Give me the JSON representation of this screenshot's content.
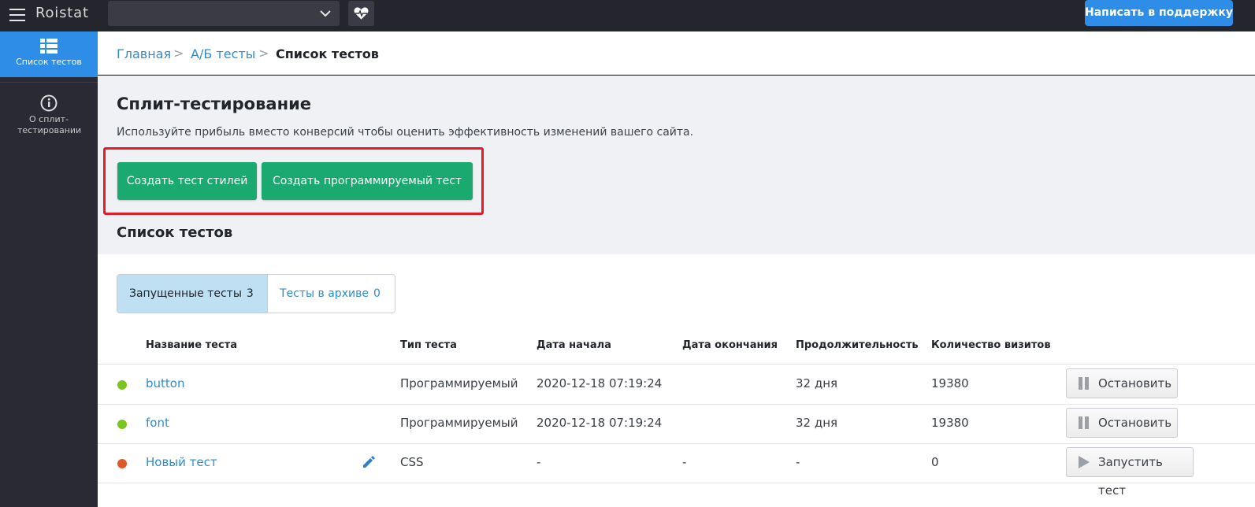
{
  "app": {
    "logo": "Roistat"
  },
  "topbar": {
    "project_value": "",
    "support_label": "Написать в поддержку"
  },
  "sidebar": {
    "items": [
      {
        "label": "Список тестов",
        "icon": "list-icon",
        "active": true
      },
      {
        "label": "О сплит-тестировании",
        "icon": "info-icon",
        "active": false
      }
    ]
  },
  "breadcrumb": {
    "home": "Главная",
    "ab": "А/Б тесты",
    "current": "Список тестов",
    "separator": ">"
  },
  "hero": {
    "title": "Сплит-тестирование",
    "description": "Используйте прибыль вместо конверсий чтобы оценить эффективность изменений вашего сайта.",
    "btn_style_test": "Создать тест стилей",
    "btn_program_test": "Создать программируемый тест",
    "list_title": "Список тестов"
  },
  "tabs": {
    "running_label": "Запущенные тесты",
    "running_count": "3",
    "archive_label": "Тесты в архиве",
    "archive_count": "0"
  },
  "table": {
    "headers": {
      "name": "Название теста",
      "type": "Тип теста",
      "start": "Дата начала",
      "end": "Дата окончания",
      "duration": "Продолжительность",
      "visits": "Количество визитов"
    },
    "rows": [
      {
        "status_color": "#7cc520",
        "name": "button",
        "type": "Программируемый",
        "start": "2020-12-18 07:19:24",
        "end": "",
        "duration": "32 дня",
        "visits": "19380",
        "action": "Остановить",
        "action_icon": "pause-icon"
      },
      {
        "status_color": "#7cc520",
        "name": "font",
        "type": "Программируемый",
        "start": "2020-12-18 07:19:24",
        "end": "",
        "duration": "32 дня",
        "visits": "19380",
        "action": "Остановить",
        "action_icon": "pause-icon"
      },
      {
        "status_color": "#e0582a",
        "name": "Новый тест",
        "type": "CSS",
        "start": "-",
        "end": "-",
        "duration": "-",
        "visits": "0",
        "action": "Запустить тест",
        "action_icon": "play-icon"
      }
    ]
  },
  "colors": {
    "accent": "#2e8de6",
    "green_button": "#1aa96e",
    "highlight": "#e6192a",
    "link": "#2d8ccc"
  }
}
